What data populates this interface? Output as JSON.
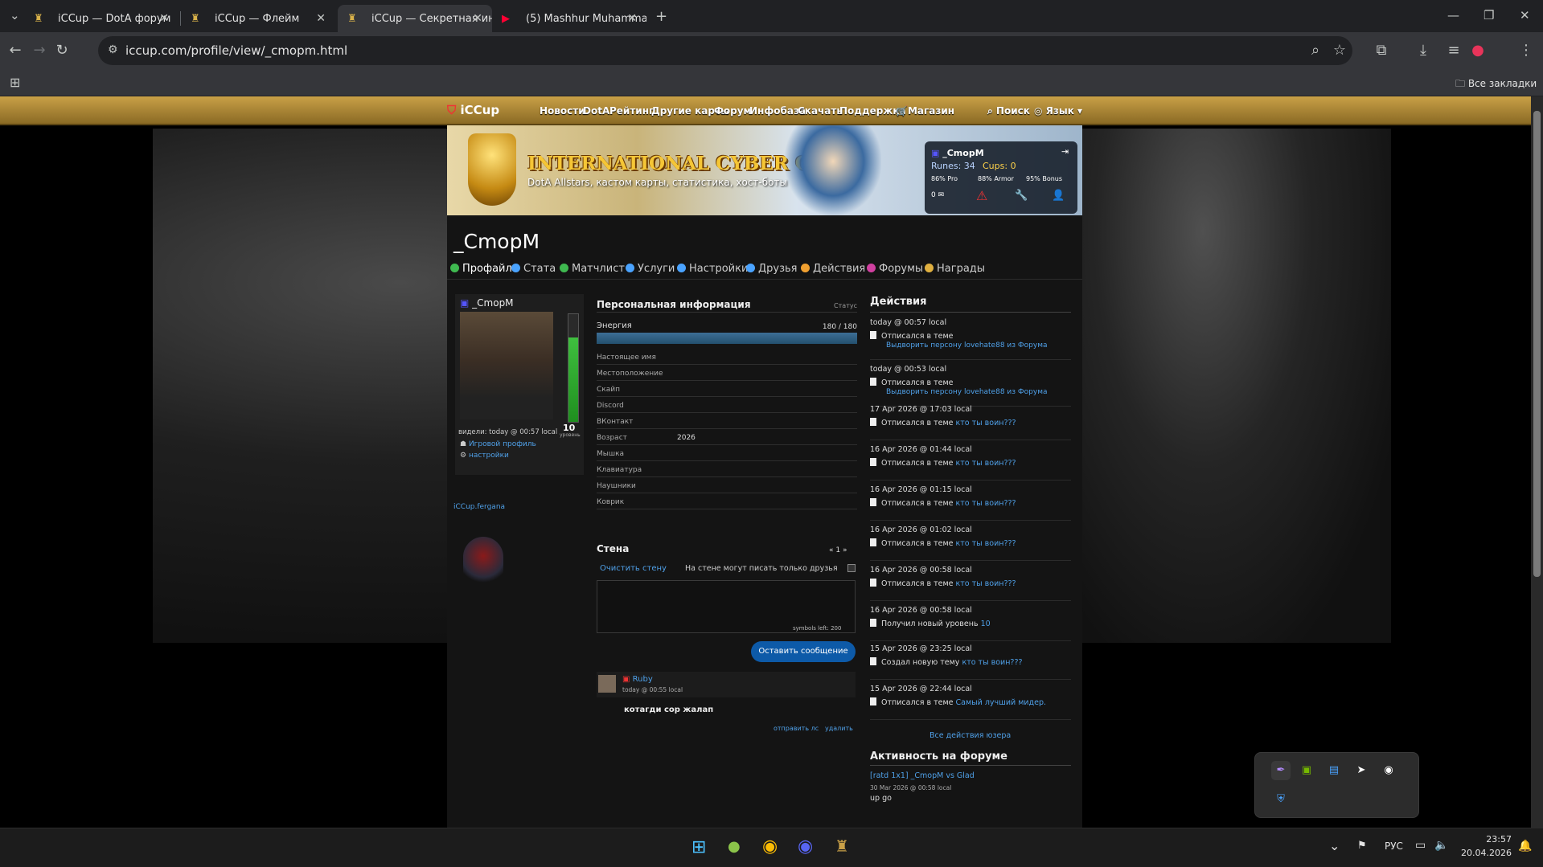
{
  "browser": {
    "tabs": [
      {
        "title": "iCCup — DotA форум",
        "active": false
      },
      {
        "title": "iCCup — Флейм",
        "active": false
      },
      {
        "title": "iCCup — Секретная информац",
        "active": true
      },
      {
        "title": "(5) Mashhur Muhammad - S",
        "active": false
      }
    ],
    "url": "iccup.com/profile/view/_cmopm.html",
    "bookmarks_label": "Все закладки"
  },
  "site": {
    "logo": "iCCup",
    "nav": [
      "Новости",
      "DotA",
      "Рейтинг",
      "Другие карты",
      "Форум",
      "Инфобаза",
      "Скачать",
      "Поддержка",
      "Магазин"
    ],
    "search_label": "Поиск",
    "lang_label": "Язык",
    "banner_title": "INTERNATIONAL CYBER CUP",
    "banner_subtitle": "DotA Allstars, кастом карты, статистика, хост-боты",
    "userbox": {
      "username": "_CmopM",
      "runes_label": "Runes: 34",
      "cups_label": "Cups: 0",
      "pro": "86% Pro",
      "armor": "88% Armor",
      "bonus": "95% Bonus",
      "mail_count": "0"
    }
  },
  "profile": {
    "name": "_CmopM",
    "tabs": [
      "Профайл",
      "Стата",
      "Матчлист",
      "Услуги",
      "Настройки",
      "Друзья",
      "Действия",
      "Форумы",
      "Награды"
    ],
    "tab_colors": [
      "#3fb950",
      "#4aa3ff",
      "#3fb950",
      "#4aa3ff",
      "#4aa3ff",
      "#4aa3ff",
      "#f0a030",
      "#d040a0",
      "#e0b040"
    ],
    "user_label": "_CmopM",
    "level_value": "10",
    "level_label": "уровень",
    "energy_level": 0.78,
    "seen": "видели: today @ 00:57 local",
    "game_profile_link": "Игровой профиль",
    "settings_link": "настройки",
    "clan_link": "iCCup.fergana"
  },
  "personal": {
    "title": "Персональная информация",
    "status_label": "Статус",
    "energy_label": "Энергия",
    "energy_value": "180 / 180",
    "energy_fraction": 1,
    "fields": [
      {
        "label": "Настоящее имя",
        "value": ""
      },
      {
        "label": "Местоположение",
        "value": ""
      },
      {
        "label": "Скайп",
        "value": ""
      },
      {
        "label": "Discord",
        "value": ""
      },
      {
        "label": "ВКонтакт",
        "value": ""
      },
      {
        "label": "Возраст",
        "value": "2026"
      },
      {
        "label": "Мышка",
        "value": ""
      },
      {
        "label": "Клавиатура",
        "value": ""
      },
      {
        "label": "Наушники",
        "value": ""
      },
      {
        "label": "Коврик",
        "value": ""
      }
    ]
  },
  "wall": {
    "title": "Стена",
    "pager": "« 1 »",
    "clear_link": "Очистить стену",
    "friends_only_label": "На стене могут писать только друзья",
    "symbols_left": "symbols left: 200",
    "submit": "Оставить сообщение",
    "post": {
      "author": "Ruby",
      "time": "today @ 00:55 local",
      "text": "котагди сор жалап",
      "send_pm": "отправить лс",
      "delete": "удалить"
    }
  },
  "actions": {
    "title": "Действия",
    "items": [
      {
        "time": "today @ 00:57 local",
        "text": "Отписался в теме",
        "link": "Выдворить персону lovehate88 из Форума"
      },
      {
        "time": "today @ 00:53 local",
        "text": "Отписался в теме",
        "link": "Выдворить персону lovehate88 из Форума"
      },
      {
        "time": "17 Apr 2026 @ 17:03 local",
        "text": "Отписался в теме",
        "link": "кто ты воин???"
      },
      {
        "time": "16 Apr 2026 @ 01:44 local",
        "text": "Отписался в теме",
        "link": "кто ты воин???"
      },
      {
        "time": "16 Apr 2026 @ 01:15 local",
        "text": "Отписался в теме",
        "link": "кто ты воин???"
      },
      {
        "time": "16 Apr 2026 @ 01:02 local",
        "text": "Отписался в теме",
        "link": "кто ты воин???"
      },
      {
        "time": "16 Apr 2026 @ 00:58 local",
        "text": "Отписался в теме",
        "link": "кто ты воин???"
      },
      {
        "time": "16 Apr 2026 @ 00:58 local",
        "text": "Получил новый уровень",
        "link": "10"
      },
      {
        "time": "15 Apr 2026 @ 23:25 local",
        "text": "Создал новую тему",
        "link": "кто ты воин???"
      },
      {
        "time": "15 Apr 2026 @ 22:44 local",
        "text": "Отписался в теме",
        "link": "Самый лучший мидер."
      }
    ],
    "all_link": "Все действия юзера"
  },
  "forum_activity": {
    "title": "Активность на форуме",
    "topic": "[ratd 1x1] _CmopM vs Glad",
    "time": "30 Mar 2026 @ 00:58 local",
    "text": "up go"
  },
  "taskbar": {
    "lang": "РУС",
    "time": "23:57",
    "date": "20.04.2026"
  }
}
